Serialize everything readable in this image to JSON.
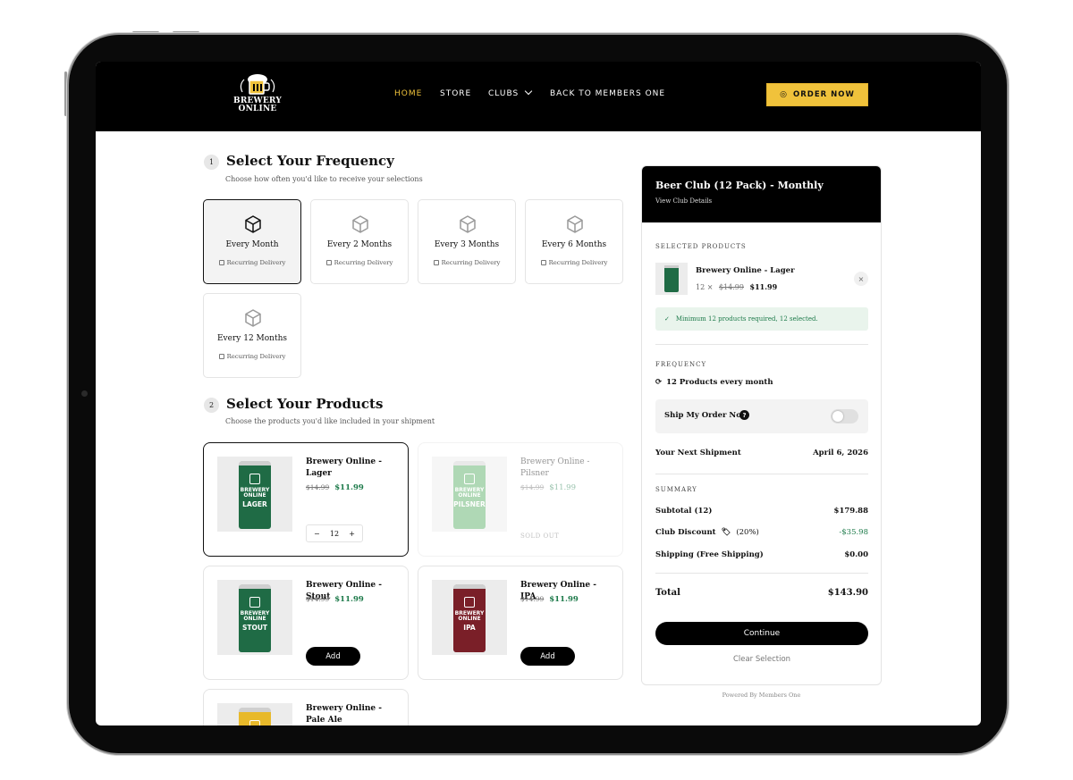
{
  "colors": {
    "accent": "#f0c23b",
    "price_green": "#1d7a4a",
    "black": "#000000"
  },
  "header": {
    "brand": "BREWERY ONLINE",
    "nav": [
      {
        "label": "HOME",
        "active": true
      },
      {
        "label": "STORE",
        "active": false
      },
      {
        "label": "CLUBS",
        "active": false
      },
      {
        "label": "BACK TO MEMBERS ONE",
        "active": false
      }
    ],
    "order_label": "ORDER NOW"
  },
  "frequency": {
    "step": "1",
    "title": "Select Your Frequency",
    "subtitle": "Choose how often you'd like to receive your selections",
    "options": [
      {
        "label": "Every Month",
        "sub": "Recurring Delivery",
        "selected": true
      },
      {
        "label": "Every 2 Months",
        "sub": "Recurring Delivery",
        "selected": false
      },
      {
        "label": "Every 3 Months",
        "sub": "Recurring Delivery",
        "selected": false
      },
      {
        "label": "Every 6 Months",
        "sub": "Recurring Delivery",
        "selected": false
      },
      {
        "label": "Every 12 Months",
        "sub": "Recurring Delivery",
        "selected": false
      }
    ]
  },
  "products": {
    "step": "2",
    "title": "Select Your Products",
    "subtitle": "Choose the products you'd like included in your shipment",
    "items": [
      {
        "name": "Brewery Online - Lager",
        "old_price": "$14.99",
        "price": "$11.99",
        "can_label": "LAGER",
        "can_brand": "BREWERY ONLINE",
        "qty": "12",
        "minus": "−",
        "plus": "+"
      },
      {
        "name": "Brewery Online - Pilsner",
        "old_price": "$14.99",
        "price": "$11.99",
        "can_label": "PILSNER",
        "can_brand": "BREWERY ONLINE",
        "status": "SOLD OUT"
      },
      {
        "name": "Brewery Online - Stout",
        "old_price": "$14.99",
        "price": "$11.99",
        "can_label": "STOUT",
        "can_brand": "BREWERY ONLINE",
        "action": "Add"
      },
      {
        "name": "Brewery Online - IPA",
        "old_price": "$14.99",
        "price": "$11.99",
        "can_label": "IPA",
        "can_brand": "BREWERY ONLINE",
        "action": "Add"
      },
      {
        "name": "Brewery Online - Pale Ale"
      }
    ]
  },
  "summary": {
    "club_title": "Beer Club (12 Pack) - Monthly",
    "club_link": "View Club Details",
    "selected_caption": "SELECTED PRODUCTS",
    "selected_item": {
      "name": "Brewery Online - Lager",
      "qty_text": "12 ×",
      "old_price": "$14.99",
      "price": "$11.99",
      "remove": "×"
    },
    "notice": "Minimum 12 products required, 12 selected.",
    "frequency_caption": "FREQUENCY",
    "frequency_text": "12 Products every month",
    "ship_now_label": "Ship My Order Now",
    "ship_now_enabled": false,
    "next_shipment_label": "Your Next Shipment",
    "next_shipment_date": "April 6, 2026",
    "summary_caption": "SUMMARY",
    "subtotal_label": "Subtotal (12)",
    "subtotal": "$179.88",
    "discount_label": "Club Discount",
    "discount_pct": "(20%)",
    "discount": "-$35.98",
    "shipping_label": "Shipping (Free Shipping)",
    "shipping": "$0.00",
    "total_label": "Total",
    "total": "$143.90",
    "continue_label": "Continue",
    "clear_label": "Clear Selection",
    "powered": "Powered By Members One"
  }
}
